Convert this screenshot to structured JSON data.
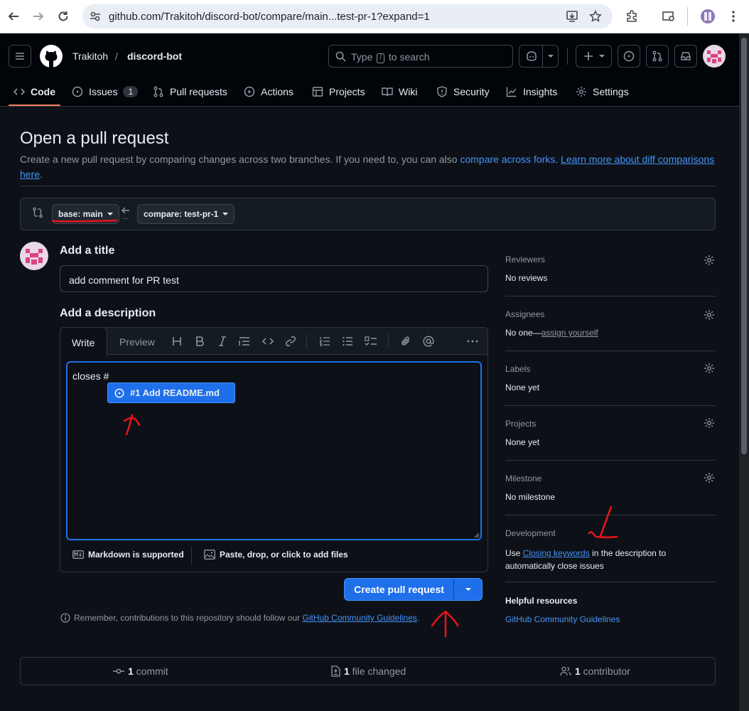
{
  "browser": {
    "url": "github.com/Trakitoh/discord-bot/compare/main...test-pr-1?expand=1"
  },
  "header": {
    "owner": "Trakitoh",
    "separator": "/",
    "repo": "discord-bot",
    "search_prefix": "Type",
    "search_key": "/",
    "search_suffix": "to search"
  },
  "repo_tabs": [
    {
      "label": "Code",
      "icon": "code-icon"
    },
    {
      "label": "Issues",
      "icon": "issue-icon",
      "count": "1"
    },
    {
      "label": "Pull requests",
      "icon": "pull-request-icon"
    },
    {
      "label": "Actions",
      "icon": "play-icon"
    },
    {
      "label": "Projects",
      "icon": "table-icon"
    },
    {
      "label": "Wiki",
      "icon": "book-icon"
    },
    {
      "label": "Security",
      "icon": "shield-icon"
    },
    {
      "label": "Insights",
      "icon": "graph-icon"
    },
    {
      "label": "Settings",
      "icon": "gear-icon"
    }
  ],
  "page": {
    "title": "Open a pull request",
    "subtitle_1": "Create a new pull request by comparing changes across two branches. If you need to, you can also ",
    "compare_forks": "compare across forks.",
    "learn_more_1": "Learn more about diff comparisons",
    "learn_more_2": "here",
    "period": "."
  },
  "branches": {
    "base": "base: main",
    "compare": "compare: test-pr-1",
    "dots": "..."
  },
  "form": {
    "title_heading": "Add a title",
    "title_value": "add comment for PR test",
    "desc_heading": "Add a description",
    "tab_write": "Write",
    "tab_preview": "Preview",
    "body_text": "closes #",
    "suggestion": "#1 Add README.md",
    "markdown_note": "Markdown is supported",
    "attach_note": "Paste, drop, or click to add files",
    "submit": "Create pull request",
    "reminder": "Remember, contributions to this repository should follow our ",
    "guidelines_link": "GitHub Community Guidelines",
    "reminder_end": "."
  },
  "sidebar": {
    "reviewers": {
      "label": "Reviewers",
      "value": "No reviews"
    },
    "assignees": {
      "label": "Assignees",
      "value": "No one—",
      "link": "assign yourself"
    },
    "labels": {
      "label": "Labels",
      "value": "None yet"
    },
    "projects": {
      "label": "Projects",
      "value": "None yet"
    },
    "milestone": {
      "label": "Milestone",
      "value": "No milestone"
    },
    "development": {
      "label": "Development",
      "text_1": "Use ",
      "link": "Closing keywords",
      "text_2": " in the description to",
      "text_3": "automatically close issues"
    },
    "helpful": {
      "label": "Helpful resources",
      "link": "GitHub Community Guidelines"
    }
  },
  "summary": {
    "commits_count": "1",
    "commits_label": " commit",
    "files_count": "1",
    "files_label": " file changed",
    "contrib_count": "1",
    "contrib_label": " contributor"
  },
  "colors": {
    "background": "#0d1117",
    "header": "#010409",
    "accent": "#4493f8",
    "primary_button": "#1f6feb",
    "annotation": "#e8141a"
  }
}
